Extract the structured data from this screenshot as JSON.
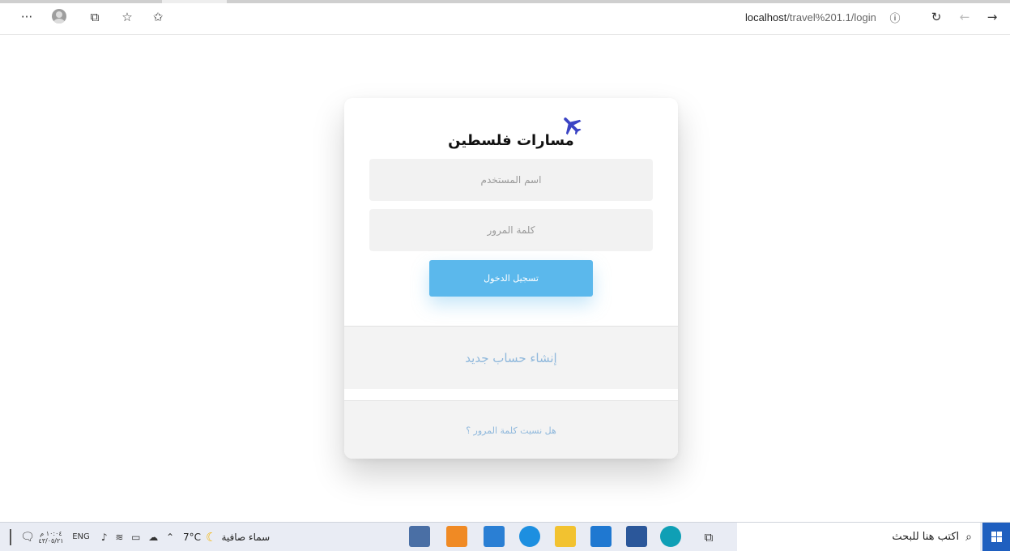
{
  "browser": {
    "menu_label": "···",
    "url_host": "localhost",
    "url_path": "/travel%201.1/login",
    "info_icon": "info-icon",
    "refresh_icon": "refresh-icon",
    "back_icon": "back-arrow-icon",
    "forward_icon": "forward-arrow-icon"
  },
  "login": {
    "brand": "مسارات فلسطين",
    "username_placeholder": "اسم المستخدم",
    "password_placeholder": "كلمة المرور",
    "login_button": "تسجيل الدخول",
    "signup_link": "إنشاء حساب جديد",
    "forgot_link": "هل نسيت كلمة المرور ؟",
    "accent_color": "#5bb8ec",
    "plane_color": "#3b44c4"
  },
  "taskbar": {
    "search_placeholder": "اكتب هنا للبحث",
    "weather_temp": "7°C",
    "weather_text": "سماء صافية",
    "language": "ENG",
    "time": "١٠:٠٤ م",
    "date": "٤٣/٠٥/٢١"
  }
}
